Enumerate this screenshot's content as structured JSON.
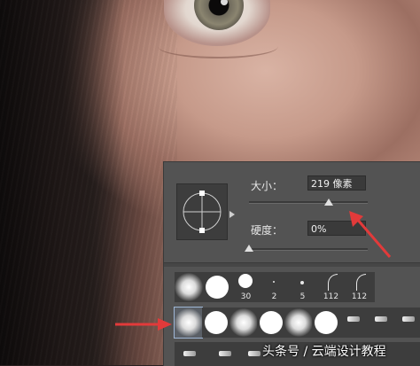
{
  "brush_panel": {
    "size_label": "大小：",
    "size_value": "219 像素",
    "hardness_label": "硬度：",
    "hardness_value": "0%",
    "size_slider_fraction": 0.67,
    "hardness_slider_fraction": 0.0
  },
  "presets_row1": [
    {
      "type": "soft-round",
      "label": ""
    },
    {
      "type": "hard-round",
      "label": ""
    },
    {
      "type": "hard-round",
      "label": "30"
    },
    {
      "type": "small-dot",
      "label": "2"
    },
    {
      "type": "small-dot",
      "label": "5"
    },
    {
      "type": "stroke",
      "label": "112"
    },
    {
      "type": "stroke",
      "label": "112"
    }
  ],
  "presets_row2": [
    {
      "type": "soft-round",
      "label": "",
      "selected": true
    },
    {
      "type": "hard-round",
      "label": ""
    },
    {
      "type": "soft-round",
      "label": ""
    },
    {
      "type": "hard-round",
      "label": ""
    },
    {
      "type": "soft-round",
      "label": ""
    },
    {
      "type": "hard-round",
      "label": ""
    },
    {
      "type": "tip",
      "label": ""
    },
    {
      "type": "tip",
      "label": ""
    },
    {
      "type": "tip",
      "label": ""
    }
  ],
  "watermark": "头条号 / 云端设计教程",
  "colors": {
    "panel": "#535353",
    "arrow": "#e23a3a"
  }
}
